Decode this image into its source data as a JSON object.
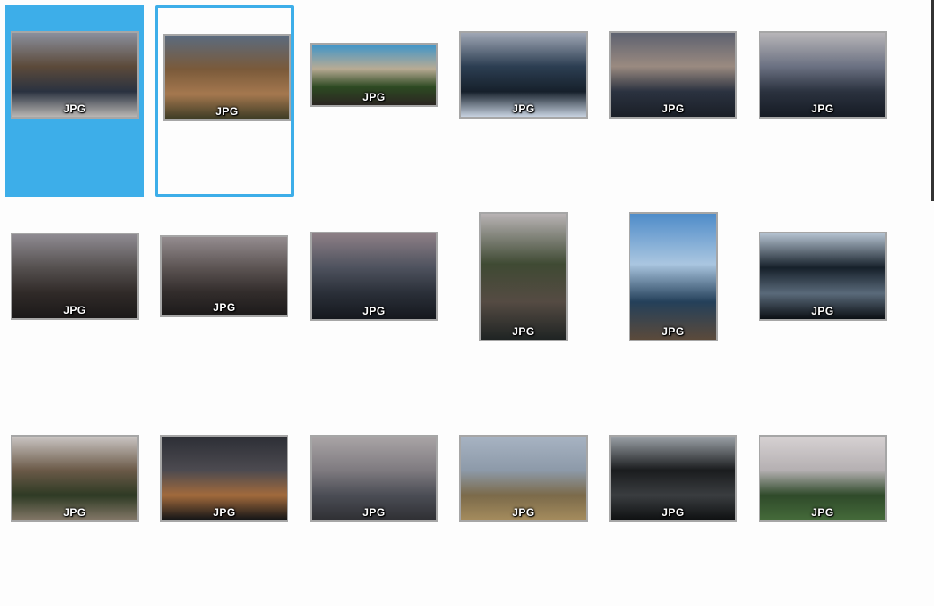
{
  "view": {
    "selected_index": 0,
    "current_index": 1
  },
  "items": [
    {
      "type_label": "JPG",
      "orientation": "landscape",
      "scene": "pier at lake with people, autumn trees",
      "palette": [
        "#8a8f9c",
        "#5c4a3a",
        "#2a3240",
        "#b9b6b3"
      ]
    },
    {
      "type_label": "JPG",
      "orientation": "landscape",
      "scene": "lakeshore beach with dogs",
      "palette": [
        "#5b6b7e",
        "#7a5a3a",
        "#a5784f",
        "#3b3a24"
      ]
    },
    {
      "type_label": "JPG",
      "orientation": "landscape",
      "scene": "triumphal arch with tourists",
      "palette": [
        "#3f95c9",
        "#b8ab94",
        "#2d4a22",
        "#2b2622"
      ]
    },
    {
      "type_label": "JPG",
      "orientation": "landscape",
      "scene": "tilted lake view with boat",
      "palette": [
        "#9fa6b4",
        "#2c3e52",
        "#16202b",
        "#c7d2e0"
      ]
    },
    {
      "type_label": "JPG",
      "orientation": "landscape",
      "scene": "cloudy sunset over lake",
      "palette": [
        "#5e6270",
        "#9a8a80",
        "#2b3240",
        "#1a1f27"
      ]
    },
    {
      "type_label": "JPG",
      "orientation": "landscape",
      "scene": "jetty and sailboat at dusk",
      "palette": [
        "#b7b5b8",
        "#6b7182",
        "#2b323f",
        "#161b24"
      ]
    },
    {
      "type_label": "JPG",
      "orientation": "landscape",
      "scene": "dog in shallow lake water",
      "palette": [
        "#8f8b92",
        "#55504f",
        "#302a28",
        "#1b1919"
      ]
    },
    {
      "type_label": "JPG",
      "orientation": "landscape",
      "scene": "dog in shallow lake water",
      "palette": [
        "#948c8f",
        "#5b5352",
        "#332d2c",
        "#1c1a1a"
      ]
    },
    {
      "type_label": "JPG",
      "orientation": "landscape",
      "scene": "sunset clouds over lake",
      "palette": [
        "#8d7f86",
        "#4e525e",
        "#2a2f38",
        "#15181e"
      ]
    },
    {
      "type_label": "JPG",
      "orientation": "portrait",
      "scene": "boardwalk to lakeside house",
      "palette": [
        "#b8b3b4",
        "#3f4a33",
        "#554b43",
        "#1f2423"
      ]
    },
    {
      "type_label": "JPG",
      "orientation": "portrait",
      "scene": "pier with people under blue sky",
      "palette": [
        "#4f8cc9",
        "#aac6e0",
        "#24405a",
        "#5b4a3b"
      ]
    },
    {
      "type_label": "JPG",
      "orientation": "landscape",
      "scene": "tree silhouette over lake",
      "palette": [
        "#b4c2d0",
        "#16202a",
        "#5a6a7a",
        "#0b0f14"
      ]
    },
    {
      "type_label": "JPG",
      "orientation": "landscape",
      "scene": "person by shore with autumn trees",
      "palette": [
        "#c9c4c2",
        "#6b5a48",
        "#2e3a24",
        "#847868"
      ]
    },
    {
      "type_label": "JPG",
      "orientation": "landscape",
      "scene": "dark storm clouds at sunset",
      "palette": [
        "#2d2f36",
        "#4c4a50",
        "#a26a3c",
        "#111316"
      ]
    },
    {
      "type_label": "JPG",
      "orientation": "landscape",
      "scene": "overcast harbour with boats",
      "palette": [
        "#a9a4a6",
        "#7f7b80",
        "#4b4d55",
        "#2f2f33"
      ]
    },
    {
      "type_label": "JPG",
      "orientation": "landscape",
      "scene": "reeds and lake under pale sky",
      "palette": [
        "#a7b3c2",
        "#8d9aa9",
        "#7b6a4a",
        "#a58c5d"
      ]
    },
    {
      "type_label": "JPG",
      "orientation": "landscape",
      "scene": "dark trees along lakeside path",
      "palette": [
        "#9aa0a6",
        "#1a1c1e",
        "#3a3d40",
        "#0e1011"
      ]
    },
    {
      "type_label": "JPG",
      "orientation": "landscape",
      "scene": "park lawn with tree line",
      "palette": [
        "#d6d1d2",
        "#b5b0b2",
        "#2f4a2a",
        "#456b3a"
      ]
    }
  ]
}
